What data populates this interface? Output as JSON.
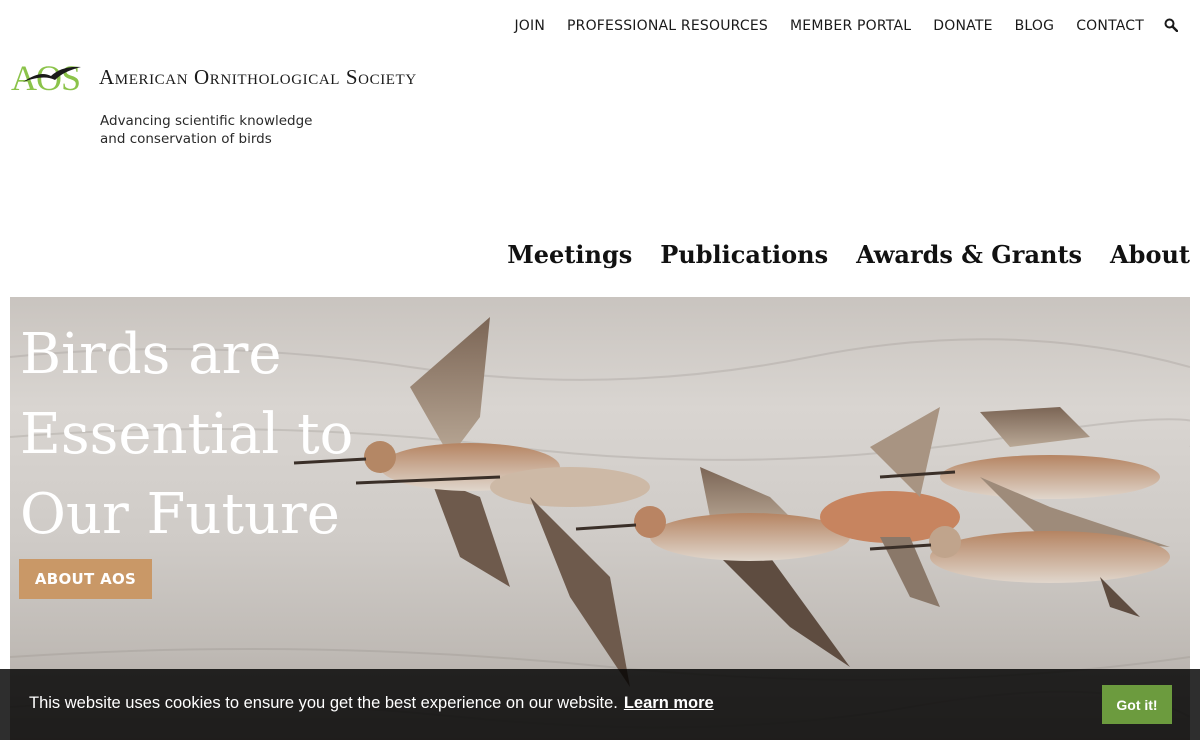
{
  "utility_nav": [
    {
      "label": "JOIN",
      "name": "join-link"
    },
    {
      "label": "PROFESSIONAL RESOURCES",
      "name": "professional-resources-link"
    },
    {
      "label": "MEMBER PORTAL",
      "name": "member-portal-link"
    },
    {
      "label": "DONATE",
      "name": "donate-link"
    },
    {
      "label": "BLOG",
      "name": "blog-link"
    },
    {
      "label": "CONTACT",
      "name": "contact-link"
    }
  ],
  "logo": {
    "letters": "AOS",
    "org_name": "American Ornithological Society",
    "color": "#8bc34a"
  },
  "tagline": {
    "line1": "Advancing scientific knowledge",
    "line2": "and conservation of birds"
  },
  "primary_nav": [
    {
      "label": "Meetings"
    },
    {
      "label": "Publications"
    },
    {
      "label": "Awards & Grants"
    },
    {
      "label": "About"
    }
  ],
  "hero": {
    "title_line1": "Birds are",
    "title_line2": "Essential to",
    "title_line3": "Our Future",
    "button_label": "ABOUT AOS",
    "button_color": "#c99867"
  },
  "cookie": {
    "message": "This website uses cookies to ensure you get the best experience on our website.",
    "learn_more": "Learn more",
    "accept_label": "Got it!",
    "accept_color": "#6c9b3e"
  },
  "icons": {
    "search": "search-icon",
    "logo_bird": "bird-silhouette-icon"
  }
}
